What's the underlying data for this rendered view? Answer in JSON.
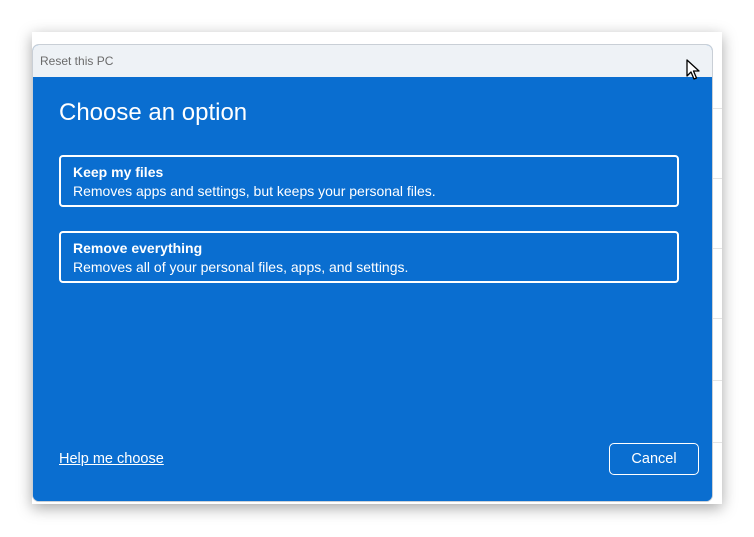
{
  "dialog": {
    "title": "Reset this PC",
    "heading": "Choose an option",
    "options": [
      {
        "title": "Keep my files",
        "description": "Removes apps and settings, but keeps your personal files."
      },
      {
        "title": "Remove everything",
        "description": "Removes all of your personal files, apps, and settings."
      }
    ],
    "help_link": "Help me choose",
    "cancel_label": "Cancel"
  },
  "colors": {
    "accent": "#0A6ED0",
    "titlebar": "#EEF2F6",
    "text": "#FFFFFF"
  },
  "icons": [
    "mouse-pointer-icon"
  ]
}
